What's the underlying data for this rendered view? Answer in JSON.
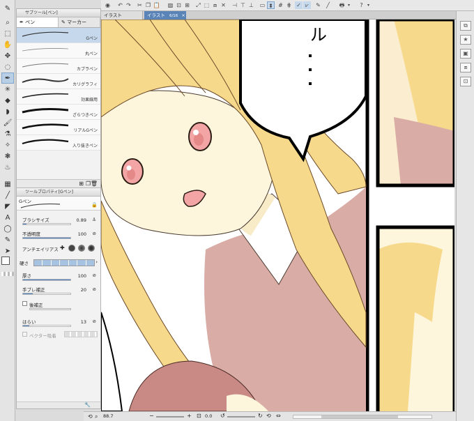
{
  "subtool_panel": {
    "title": "サブツール[ペン]",
    "tabs": [
      "ペン",
      "マーカー"
    ],
    "brushes": [
      "Gペン",
      "丸ペン",
      "カブラペン",
      "カリグラフィ",
      "効果線用",
      "ざらつきペン",
      "リアルGペン",
      "入り抜きペン"
    ]
  },
  "property_panel": {
    "title": "ツールプロパティ[Gペン]",
    "brush_name": "Gペン",
    "rows": {
      "brush_size_label": "ブラシサイズ",
      "brush_size_value": "0.89",
      "opacity_label": "不透明度",
      "opacity_value": "100",
      "antialias_label": "アンチエイリアス",
      "hardness_label": "硬さ",
      "thickness_label": "厚さ",
      "thickness_value": "100",
      "stabilization_label": "手ブレ補正",
      "stabilization_value": "20",
      "post_correction_label": "後補正",
      "fade_label": "はらい",
      "fade_value": "13",
      "vector_snap_label": "ベクター吸着"
    }
  },
  "document_tabs": [
    {
      "label": "イラスト"
    },
    {
      "label": "イラスト",
      "extra": "6/16",
      "close": "×"
    }
  ],
  "status": {
    "zoom": "88.7",
    "angle": "0.0"
  },
  "colors": {
    "accent": "#4d82c7",
    "selection": "#c6d8ec",
    "hair": "#f6d98a",
    "skin": "#fdf6dc",
    "uniform": "#d9aca5",
    "eye": "#f3a5a5"
  }
}
